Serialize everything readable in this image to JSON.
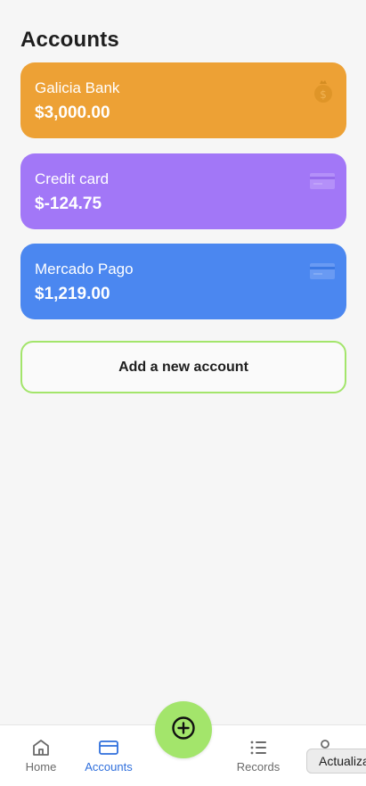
{
  "header": {
    "title": "Accounts"
  },
  "accounts": [
    {
      "name": "Galicia Bank",
      "amount": "$3,000.00",
      "color": "#eda135",
      "icon": "money-bag-icon"
    },
    {
      "name": "Credit card",
      "amount": "$-124.75",
      "color": "#a277f7",
      "icon": "credit-card-icon"
    },
    {
      "name": "Mercado Pago",
      "amount": "$1,219.00",
      "color": "#4b87f0",
      "icon": "credit-card-icon"
    }
  ],
  "add_account": {
    "label": "Add a new account",
    "border_color": "#a3e56b"
  },
  "nav": {
    "items": [
      {
        "label": "Home",
        "icon": "home-icon"
      },
      {
        "label": "Accounts",
        "icon": "card-icon",
        "active": true
      },
      {
        "label": "Records",
        "icon": "list-icon"
      },
      {
        "label": "",
        "icon": "user-icon"
      }
    ],
    "active_color": "#2f6fdc",
    "fab_icon": "plus-circle-icon",
    "fab_color": "#a3e56b"
  },
  "tooltip": {
    "text": "Actualiza"
  }
}
